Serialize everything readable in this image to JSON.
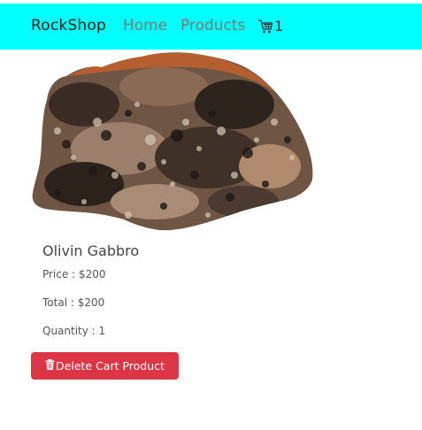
{
  "nav": {
    "brand": "RockShop",
    "links": [
      "Home",
      "Products"
    ],
    "cart_icon": "cart-icon",
    "cart_count": "1"
  },
  "product": {
    "name": "Olivin Gabbro",
    "image_icon": "rock-image",
    "price_text": "Price : $200",
    "total_text": "Total : $200",
    "quantity_text": "Quantity : 1",
    "delete_label": "Delete Cart Product",
    "delete_icon": "trash-icon"
  },
  "colors": {
    "navbar": "#00ffff",
    "danger": "#dc3545"
  }
}
